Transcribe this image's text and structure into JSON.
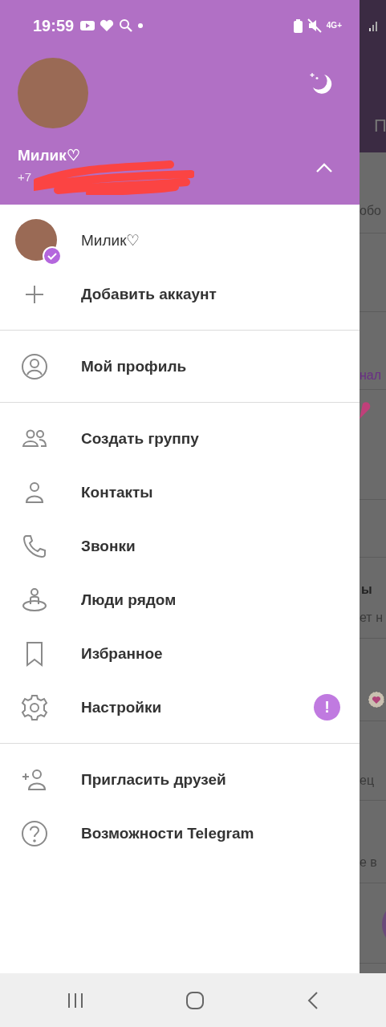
{
  "status_bar": {
    "time": "19:59",
    "network": "4G+"
  },
  "header": {
    "name": "Милик♡",
    "phone": "+7"
  },
  "accounts": [
    {
      "name": "Милик♡",
      "selected": true
    }
  ],
  "add_account": "Добавить аккаунт",
  "menu_sections": [
    {
      "items": [
        {
          "label": "Мой профиль"
        }
      ]
    },
    {
      "items": [
        {
          "label": "Создать группу"
        },
        {
          "label": "Контакты"
        },
        {
          "label": "Звонки"
        },
        {
          "label": "Люди рядом"
        },
        {
          "label": "Избранное"
        },
        {
          "label": "Настройки",
          "badge": "!"
        }
      ]
    },
    {
      "items": [
        {
          "label": "Пригласить друзей"
        },
        {
          "label": "Возможности Telegram"
        }
      ]
    }
  ],
  "background_chats": {
    "tab": "П",
    "snippets": [
      {
        "text": "обо",
        "kind": "plain"
      },
      {
        "text": "нал",
        "kind": "link"
      },
      {
        "kind": "heart"
      },
      {
        "text": "ы",
        "kind": "bold"
      },
      {
        "text": "ет н",
        "kind": "plain"
      },
      {
        "kind": "flower"
      },
      {
        "text": "ец",
        "kind": "plain"
      },
      {
        "text": "е в",
        "kind": "plain"
      }
    ]
  }
}
